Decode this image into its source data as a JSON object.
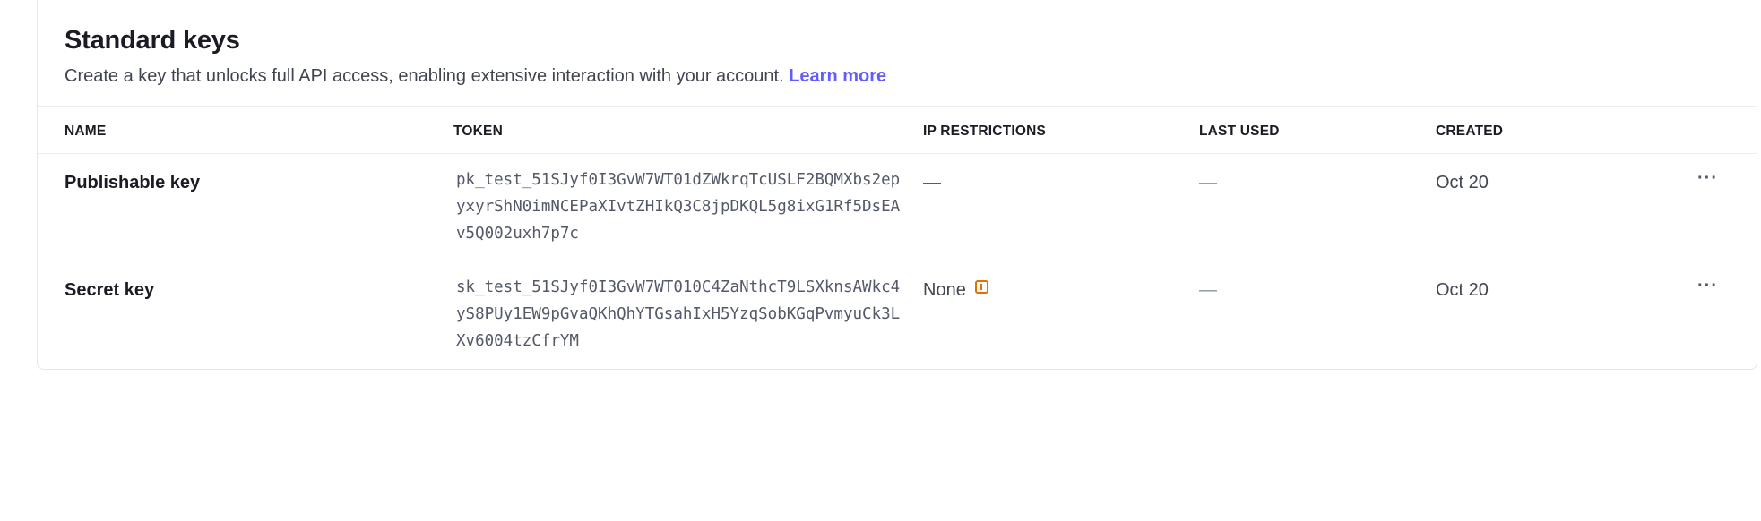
{
  "section": {
    "title": "Standard keys",
    "description": "Create a key that unlocks full API access, enabling extensive interaction with your account.",
    "learn_more": "Learn more"
  },
  "table": {
    "headers": [
      "NAME",
      "TOKEN",
      "IP RESTRICTIONS",
      "LAST USED",
      "CREATED"
    ],
    "rows": [
      {
        "name": "Publishable key",
        "token": "pk_test_51SJyf0I3GvW7WT01dZWkrqTcUSLF2BQMXbs2epyxyrShN0imNCEPaXIvtZHIkQ3C8jpDKQL5g8ixG1Rf5DsEAv5Q002uxh7p7c",
        "ip_restrictions": "—",
        "last_used": "—",
        "created": "Oct 20",
        "menu": "···"
      },
      {
        "name": "Secret key",
        "token": "sk_test_51SJyf0I3GvW7WT010C4ZaNthcT9LSXknsAWkc4yS8PUy1EW9pGvaQKhQhYTGsahIxH5YzqSobKGqPvmyuCk3LXv6004tzCfrYM",
        "ip_restrictions": "None",
        "last_used": "—",
        "created": "Oct 20",
        "menu": "···"
      }
    ]
  },
  "colors": {
    "link": "#635bff",
    "warning_icon": "#e56f00",
    "border": "#ebeef1"
  },
  "icons": {
    "ip_restriction_info": "info-icon",
    "row_menu": "more-horizontal-icon"
  }
}
